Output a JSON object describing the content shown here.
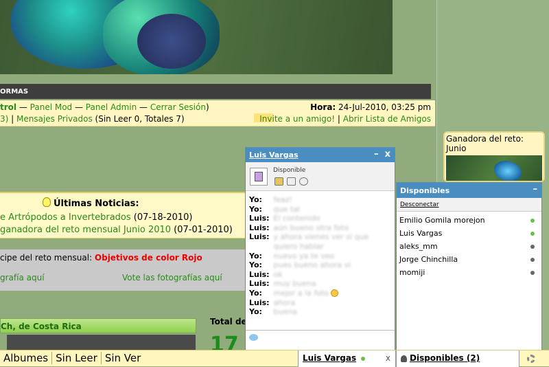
{
  "forum": {
    "header_label": "ORMAS",
    "user_links_prefix": "trol",
    "user_links": [
      "Panel Mod",
      "Panel Admin",
      "Cerrar Sesión"
    ],
    "clock_label": "Hora:",
    "clock_value": "24-Jul-2010, 03:25 pm",
    "pm_prefix": "3)",
    "pm_link": "Mensajes Privados",
    "pm_info": "(Sin Leer 0, Totales 7)",
    "invite_link": "Invite a un amigo!",
    "friends_link": "Abrir Lista de Amigos"
  },
  "news": {
    "title": "Últimas Noticias:",
    "items": [
      {
        "link": "e Artrópodos a Invertebrados",
        "date": "(07-18-2010)"
      },
      {
        "link": "ganadora del reto mensual Junio 2010",
        "date": "(07-01-2010)"
      }
    ]
  },
  "contest": {
    "prefix": "cipe del reto mensual:",
    "name": "Objetivos de color Rojo",
    "link_left": "grafía aquí",
    "link_right": "Vote las fotografías aquí"
  },
  "gallery": {
    "title": "Ch, de Costa Rica",
    "total_label": "Total de",
    "total_value": "17"
  },
  "winner_box": {
    "title": "Ganadora del reto: Junio"
  },
  "chat_window": {
    "contact": "Luis Vargas",
    "status": "Disponible",
    "messages": [
      {
        "from": "Yo:",
        "text": "feaz!"
      },
      {
        "from": "Yo:",
        "text": "que tal"
      },
      {
        "from": "Luis:",
        "text": "El contenido"
      },
      {
        "from": "Luis:",
        "text": "aún bueno otra foto"
      },
      {
        "from": "Luis:",
        "text": "y ahora vienes ver si que"
      },
      {
        "from": "",
        "text": "quiero hablar"
      },
      {
        "from": "Yo:",
        "text": "nuevo ya te veo"
      },
      {
        "from": "Yo:",
        "text": "pues bueno ahora vi"
      },
      {
        "from": "Luis:",
        "text": "ok"
      },
      {
        "from": "Luis:",
        "text": "muy buena"
      },
      {
        "from": "Yo:",
        "text": "mejor a la foto"
      },
      {
        "from": "Luis:",
        "text": "ahora"
      },
      {
        "from": "Yo:",
        "text": "buena"
      }
    ]
  },
  "available_window": {
    "title": "Disponibles",
    "disconnect": "Desconectar",
    "users": [
      {
        "name": "Emilio Gomila morejon",
        "status_color": "#6cc04a"
      },
      {
        "name": "Luis Vargas",
        "status_color": "#6cc04a"
      },
      {
        "name": "aleks_mm",
        "status_color": "#666666"
      },
      {
        "name": "Jorge Chinchilla",
        "status_color": "#666666"
      },
      {
        "name": "momiji",
        "status_color": "#666666"
      }
    ]
  },
  "bottom_bar": {
    "tabs": [
      "Albumes",
      "Sin Leer",
      "Sin Ver"
    ],
    "chat_tab": "Luis Vargas",
    "close": "x",
    "available_tab": "Disponibles (2)"
  }
}
